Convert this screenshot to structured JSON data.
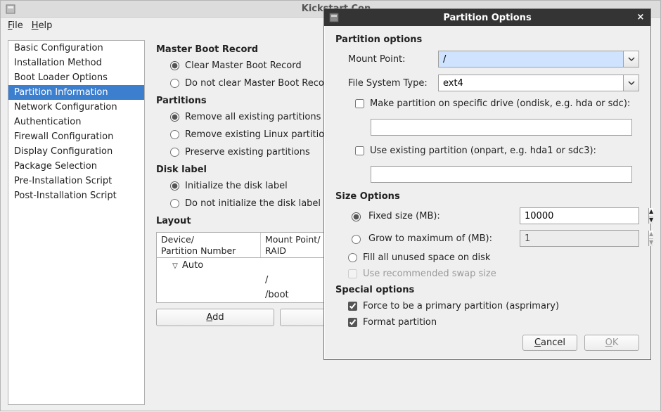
{
  "main": {
    "title": "Kickstart Con",
    "menubar": {
      "file": "File",
      "help": "Help"
    },
    "sidebar": {
      "items": [
        "Basic Configuration",
        "Installation Method",
        "Boot Loader Options",
        "Partition Information",
        "Network Configuration",
        "Authentication",
        "Firewall Configuration",
        "Display Configuration",
        "Package Selection",
        "Pre-Installation Script",
        "Post-Installation Script"
      ],
      "selected_index": 3
    },
    "mbr": {
      "heading": "Master Boot Record",
      "clear": "Clear Master Boot Record",
      "noclear": "Do not clear Master Boot Record"
    },
    "partitions": {
      "heading": "Partitions",
      "remove_all": "Remove all existing partitions",
      "remove_linux": "Remove existing Linux partitions",
      "preserve": "Preserve existing partitions"
    },
    "disklabel": {
      "heading": "Disk label",
      "init": "Initialize the disk label",
      "noinit": "Do not initialize the disk label"
    },
    "layout": {
      "heading": "Layout",
      "col1_a": "Device/",
      "col1_b": "Partition Number",
      "col2_a": "Mount Point/",
      "col2_b": "RAID",
      "rows": [
        {
          "device": "Auto",
          "mount": ""
        },
        {
          "device": "",
          "mount": "/"
        },
        {
          "device": "",
          "mount": "/boot"
        }
      ]
    },
    "buttons": {
      "add": "Add"
    }
  },
  "dialog": {
    "title": "Partition Options",
    "section_partition": "Partition options",
    "mount_label": "Mount Point:",
    "mount_value": "/",
    "fstype_label": "File System Type:",
    "fstype_value": "ext4",
    "ondisk_cb": "Make partition on specific drive (ondisk, e.g. hda or sdc):",
    "ondisk_value": "",
    "onpart_cb": "Use existing partition (onpart, e.g. hda1 or sdc3):",
    "onpart_value": "",
    "section_size": "Size Options",
    "fixed_label": "Fixed size (MB):",
    "fixed_value": "10000",
    "grow_label": "Grow to maximum of (MB):",
    "grow_value": "1",
    "fill_label": "Fill all unused space on disk",
    "swap_label": "Use recommended swap size",
    "section_special": "Special options",
    "asprimary": "Force to be a primary partition (asprimary)",
    "format": "Format partition",
    "cancel": "Cancel",
    "ok": "OK"
  }
}
